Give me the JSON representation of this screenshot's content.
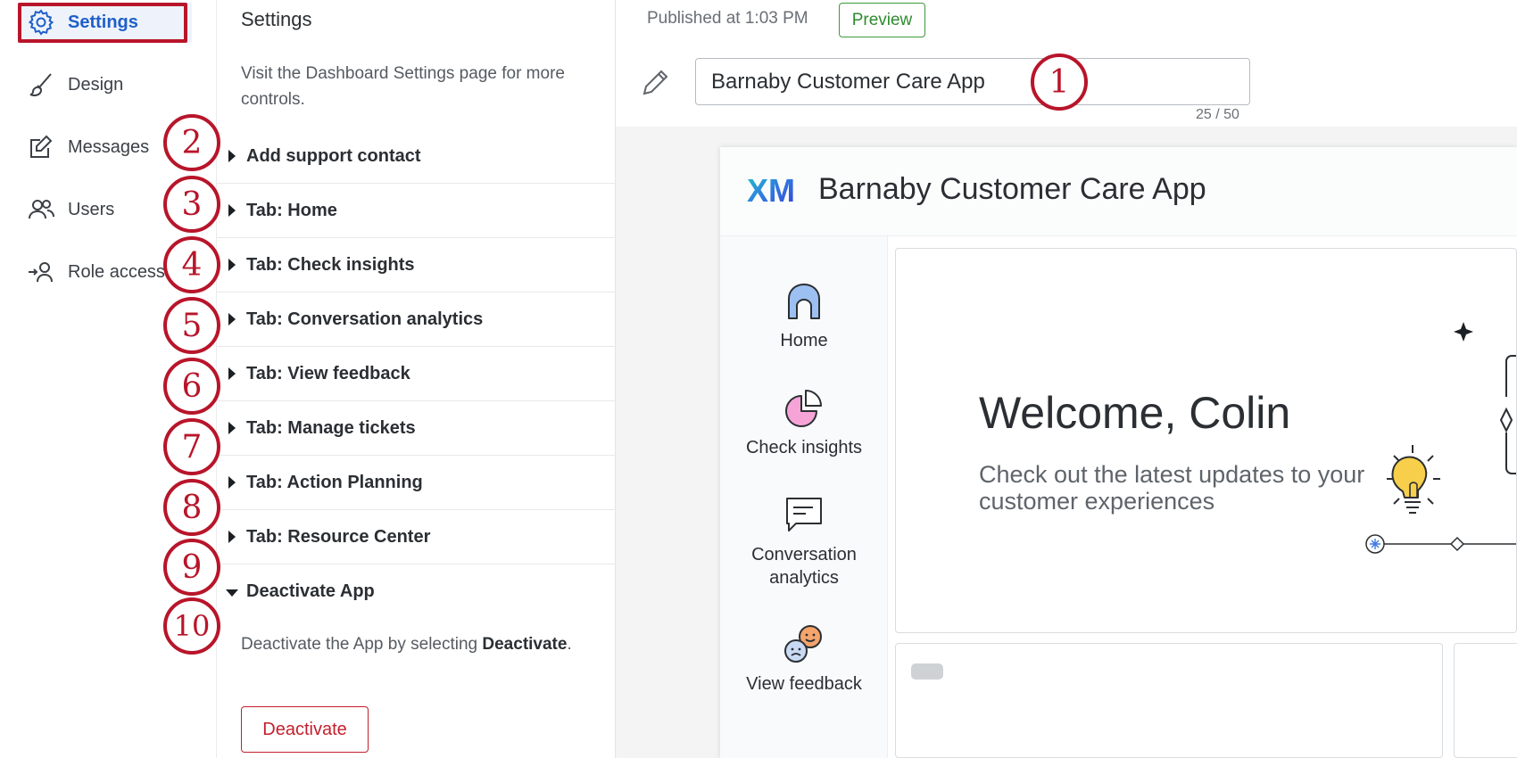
{
  "nav": {
    "items": [
      {
        "label": "Settings",
        "icon": "gear-icon"
      },
      {
        "label": "Design",
        "icon": "brush-icon"
      },
      {
        "label": "Messages",
        "icon": "edit-icon"
      },
      {
        "label": "Users",
        "icon": "users-icon"
      },
      {
        "label": "Role access",
        "icon": "role-access-icon"
      }
    ],
    "active": "Settings",
    "highlight_color": "#b8152a"
  },
  "settings": {
    "title": "Settings",
    "description": "Visit the Dashboard Settings page for more controls.",
    "sections": [
      "Add support contact",
      "Tab: Home",
      "Tab: Check insights",
      "Tab: Conversation analytics",
      "Tab: View feedback",
      "Tab: Manage tickets",
      "Tab: Action Planning",
      "Tab: Resource Center",
      "Deactivate App"
    ],
    "deactivate": {
      "text_before": "Deactivate the App by selecting ",
      "text_bold": "Deactivate",
      "text_after": ".",
      "button_label": "Deactivate",
      "button_color": "#c41f2c"
    }
  },
  "callouts": [
    "1",
    "2",
    "3",
    "4",
    "5",
    "6",
    "7",
    "8",
    "9",
    "10"
  ],
  "header": {
    "published": "Published at 1:03 PM",
    "preview_label": "Preview",
    "preview_color": "#2e8b2e",
    "app_name_value": "Barnaby Customer Care App",
    "char_count": "25 / 50"
  },
  "preview": {
    "logo_text": "XM",
    "title": "Barnaby Customer Care App",
    "nav": [
      "Home",
      "Check insights",
      "Conversation analytics",
      "View feedback"
    ],
    "welcome_title": "Welcome, Colin",
    "welcome_subtitle": "Check out the latest updates to your customer experiences"
  }
}
